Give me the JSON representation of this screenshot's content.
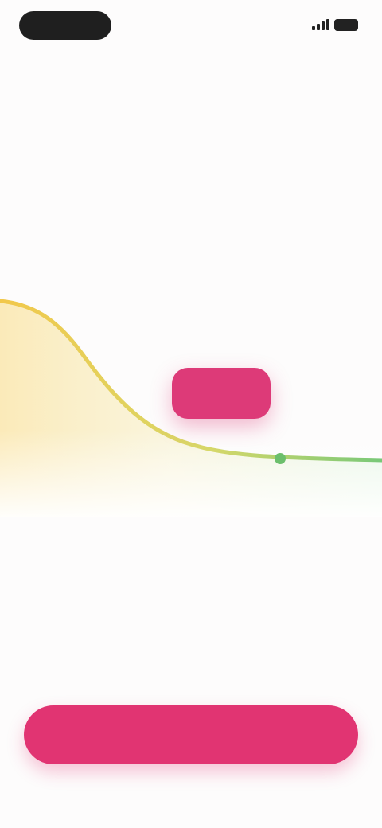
{
  "status_bar": {
    "time": "",
    "battery_icon": "battery-icon",
    "signal_icon": "signal-icon"
  },
  "header": {
    "link_text": ""
  },
  "headline": {
    "text_main": "",
    "text_accent": ""
  },
  "chart_data": {
    "type": "area",
    "x_labels": [
      "",
      ""
    ],
    "badge_text": "",
    "colors": {
      "start": "#f2c84b",
      "end": "#78c878",
      "badge": "#dd3a78"
    }
  },
  "info": {
    "title": "",
    "subtitle": ""
  },
  "cta": {
    "label": ""
  },
  "theme": {
    "accent": "#e13472",
    "background": "#fdfcfc",
    "text": "#2b2b2b"
  }
}
